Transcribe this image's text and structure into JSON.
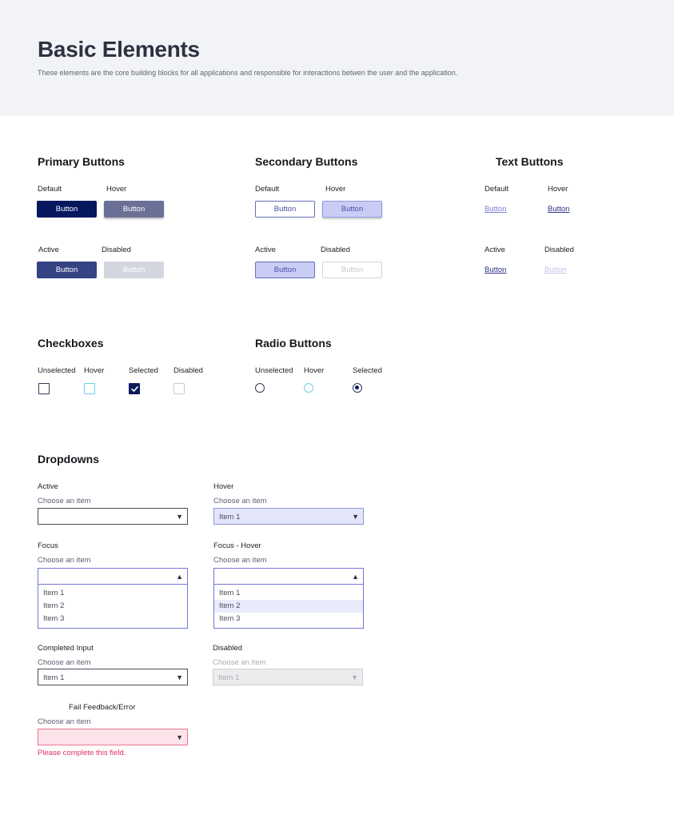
{
  "header": {
    "title": "Basic Elements",
    "description": "These elements are  the core building blocks for all applications and responsible for interactions betwen the user and the application."
  },
  "primary_buttons": {
    "title": "Primary Buttons",
    "states": {
      "default": "Default",
      "hover": "Hover",
      "active": "Active",
      "disabled": "Disabled"
    },
    "button_label": "Button"
  },
  "secondary_buttons": {
    "title": "Secondary Buttons",
    "states": {
      "default": "Default",
      "hover": "Hover",
      "active": "Active",
      "disabled": "Disabled"
    },
    "button_label": "Button"
  },
  "text_buttons": {
    "title": "Text Buttons",
    "states": {
      "default": "Default",
      "hover": "Hover",
      "active": "Active",
      "disabled": "Disabled"
    },
    "button_label": "Button"
  },
  "checkboxes": {
    "title": "Checkboxes",
    "states": {
      "unselected": "Unselected",
      "hover": "Hover",
      "selected": "Selected",
      "disabled": "Disabled"
    },
    "check_icon": "checkmark-icon"
  },
  "radio_buttons": {
    "title": "Radio Buttons",
    "states": {
      "unselected": "Unselected",
      "hover": "Hover",
      "selected": "Selected"
    }
  },
  "dropdowns": {
    "title": "Dropdowns",
    "placeholder": "Choose an item",
    "arrow_down_icon": "triangle-down-icon",
    "arrow_up_icon": "triangle-up-icon",
    "active": {
      "label": "Active",
      "value": ""
    },
    "hover": {
      "label": "Hover",
      "value": "Item 1"
    },
    "focus": {
      "label": "Focus",
      "value": "",
      "options": [
        "Item 1",
        "Item 2",
        "Item 3"
      ]
    },
    "focus_hover": {
      "label": "Focus - Hover",
      "value": "",
      "options": [
        "Item 1",
        "Item 2",
        "Item 3"
      ],
      "highlighted": "Item 2"
    },
    "completed": {
      "label": "Completed Input",
      "value": "Item 1"
    },
    "disabled": {
      "label": "Disabled",
      "value": "Item 1"
    },
    "error": {
      "label": "Fail Feedback/Error",
      "value": "",
      "message": "Please complete this field."
    }
  },
  "colors": {
    "primary": "#06175e",
    "secondary_fill": "#c9ccf5",
    "link": "#7a80d4",
    "hover_accent": "#6fd0f2",
    "error": "#e0325f",
    "header_bg": "#f2f3f7"
  }
}
